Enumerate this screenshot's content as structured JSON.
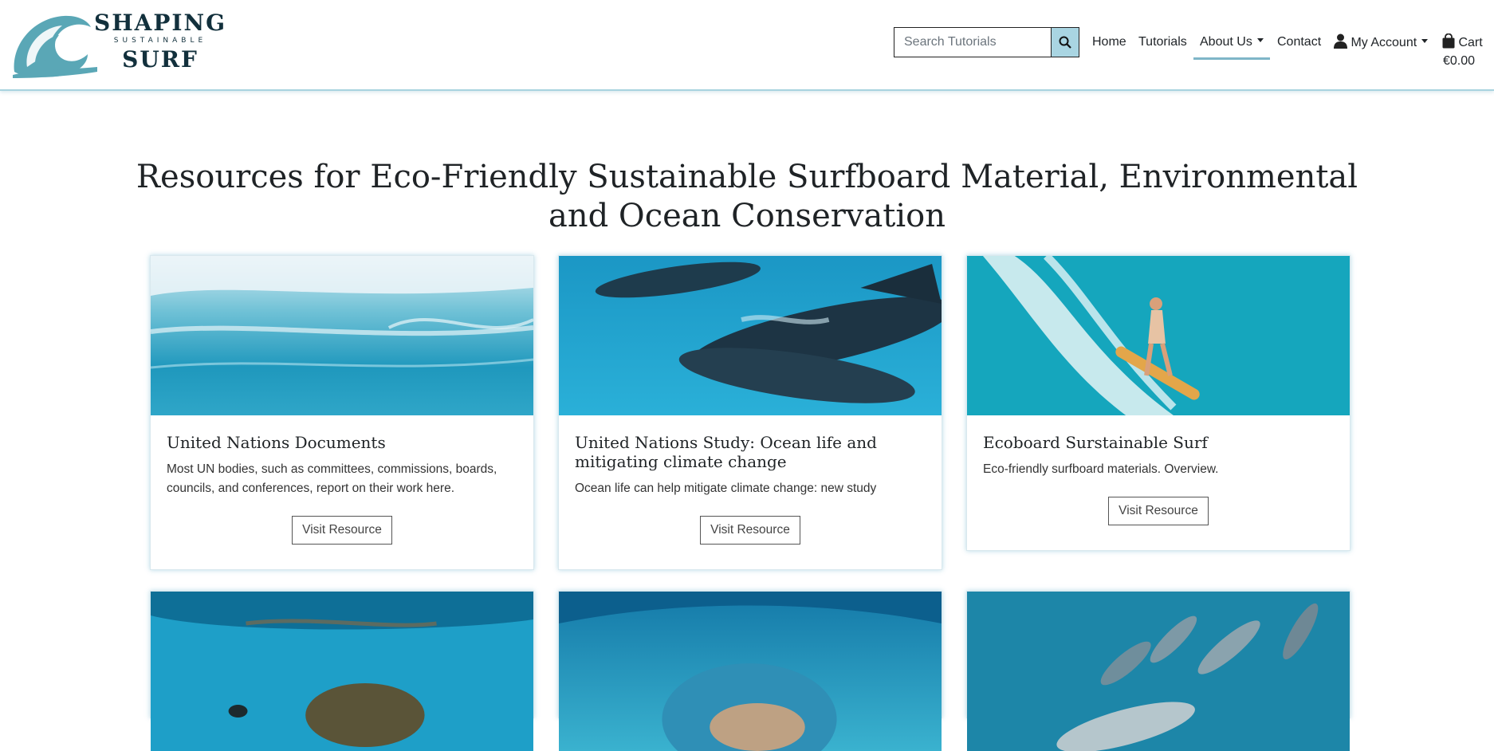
{
  "brand": {
    "line1": "SHAPING",
    "line2": "SUSTAINABLE",
    "line3": "SURF",
    "colors": {
      "wave": "#5aa7b6",
      "dark": "#12303c"
    }
  },
  "search": {
    "placeholder": "Search Tutorials",
    "icon": "search-icon"
  },
  "nav": {
    "home": "Home",
    "tutorials": "Tutorials",
    "about": "About Us",
    "contact": "Contact",
    "account": "My Account",
    "cart": "Cart",
    "cart_amount": "€0.00"
  },
  "page": {
    "title": "Resources for Eco-Friendly Sustainable Surfboard Material, Environmental and Ocean Conservation"
  },
  "cards": [
    {
      "title": "United Nations Documents",
      "text": "Most UN bodies, such as committees, commissions, boards, councils, and conferences, report on their work here.",
      "button": "Visit Resource",
      "image": "ocean-wave-closeup"
    },
    {
      "title": "United Nations Study: Ocean life and mitigating climate change",
      "text": "Ocean life can help mitigate climate change: new study",
      "button": "Visit Resource",
      "image": "dolphins-underwater"
    },
    {
      "title": "Ecoboard Surstainable Surf",
      "text": "Eco-friendly surfboard materials. Overview.",
      "button": "Visit Resource",
      "image": "surfer-aerial"
    },
    {
      "image": "sea-turtle"
    },
    {
      "image": "wave-barrel"
    },
    {
      "image": "dolphin-pod"
    }
  ],
  "accent_colors": {
    "nav_border": "#a8d3df",
    "search_button": "#a9d5e2",
    "card_shadow": "#5aaac8"
  }
}
